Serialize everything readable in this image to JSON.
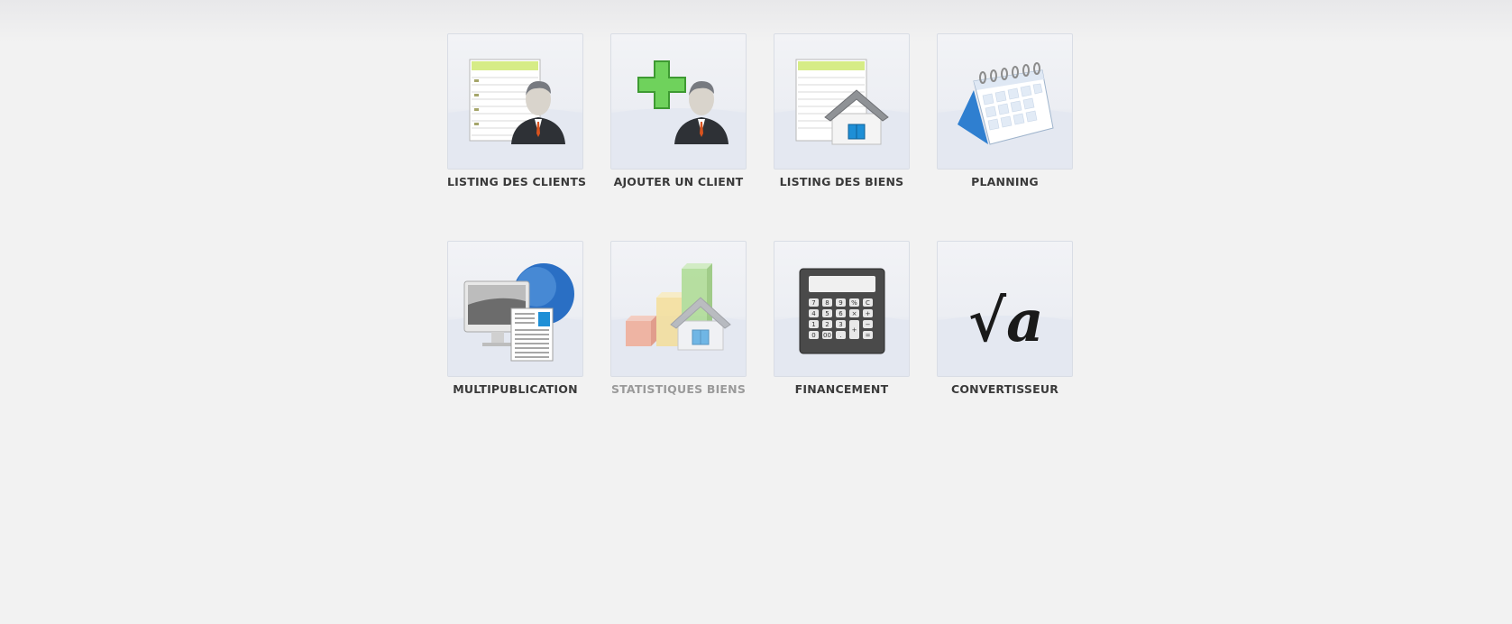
{
  "tiles": [
    {
      "label": "LISTING DES CLIENTS",
      "icon": "client-list-icon",
      "enabled": true
    },
    {
      "label": "AJOUTER UN CLIENT",
      "icon": "add-client-icon",
      "enabled": true
    },
    {
      "label": "LISTING DES BIENS",
      "icon": "property-list-icon",
      "enabled": true
    },
    {
      "label": "PLANNING",
      "icon": "calendar-icon",
      "enabled": true
    },
    {
      "label": "MULTIPUBLICATION",
      "icon": "multipublication-icon",
      "enabled": true
    },
    {
      "label": "STATISTIQUES BIENS",
      "icon": "statistics-icon",
      "enabled": false
    },
    {
      "label": "FINANCEMENT",
      "icon": "calculator-icon",
      "enabled": true
    },
    {
      "label": "CONVERTISSEUR",
      "icon": "square-root-icon",
      "enabled": true
    }
  ],
  "calculator_keys": [
    "7",
    "8",
    "9",
    "%",
    "C",
    "4",
    "5",
    "6",
    "×",
    "+",
    "1",
    "2",
    "3",
    "+",
    "−",
    "0",
    "00",
    ".",
    "="
  ],
  "converter_symbol": "√a"
}
